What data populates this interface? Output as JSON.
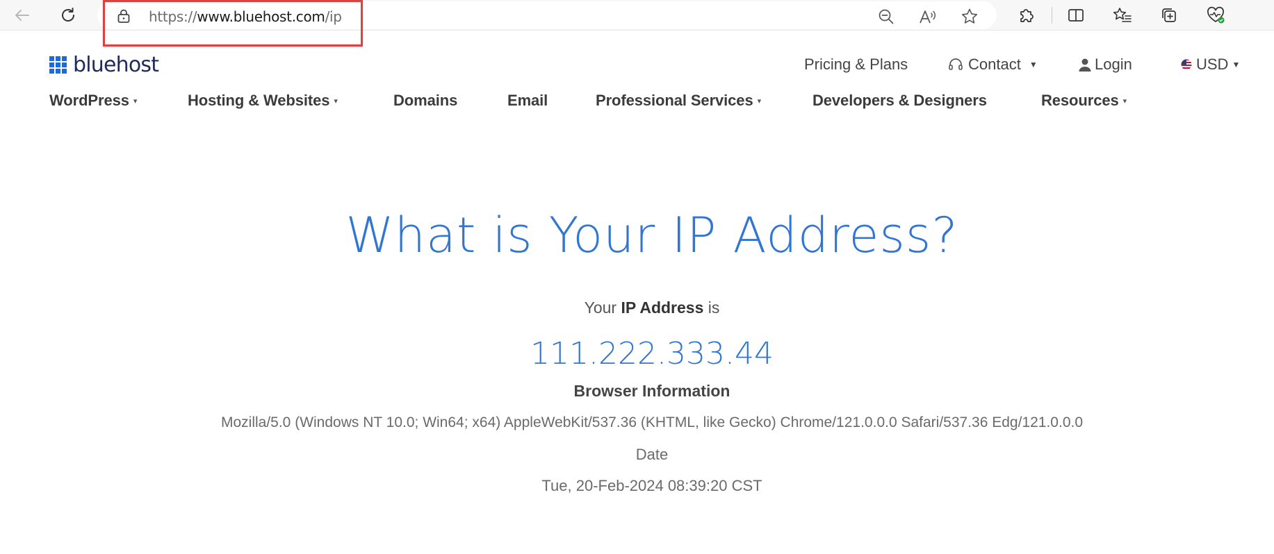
{
  "browser": {
    "url_scheme": "https://",
    "url_host": "www.bluehost.com",
    "url_path": "/ip"
  },
  "header": {
    "logo_text": "bluehost",
    "pricing": "Pricing & Plans",
    "contact": "Contact",
    "login": "Login",
    "currency": "USD"
  },
  "nav": [
    {
      "label": "WordPress",
      "dropdown": true
    },
    {
      "label": "Hosting & Websites",
      "dropdown": true
    },
    {
      "label": "Domains",
      "dropdown": false
    },
    {
      "label": "Email",
      "dropdown": false
    },
    {
      "label": "Professional Services",
      "dropdown": true
    },
    {
      "label": "Developers & Designers",
      "dropdown": false
    },
    {
      "label": "Resources",
      "dropdown": true
    }
  ],
  "main": {
    "title": "What is Your IP Address?",
    "ip_intro_prefix": "Your",
    "ip_intro_bold": "IP Address",
    "ip_intro_suffix": "is",
    "ip_value": "111.222.333.44",
    "browser_info_label": "Browser Information",
    "user_agent": "Mozilla/5.0 (Windows NT 10.0; Win64; x64) AppleWebKit/537.36 (KHTML, like Gecko) Chrome/121.0.0.0 Safari/537.36 Edg/121.0.0.0",
    "date_label": "Date",
    "date_value": "Tue, 20-Feb-2024 08:39:20 CST"
  },
  "colors": {
    "accent_blue": "#3276d4",
    "logo_blue": "#196bde",
    "highlight_red": "#e0413f"
  }
}
